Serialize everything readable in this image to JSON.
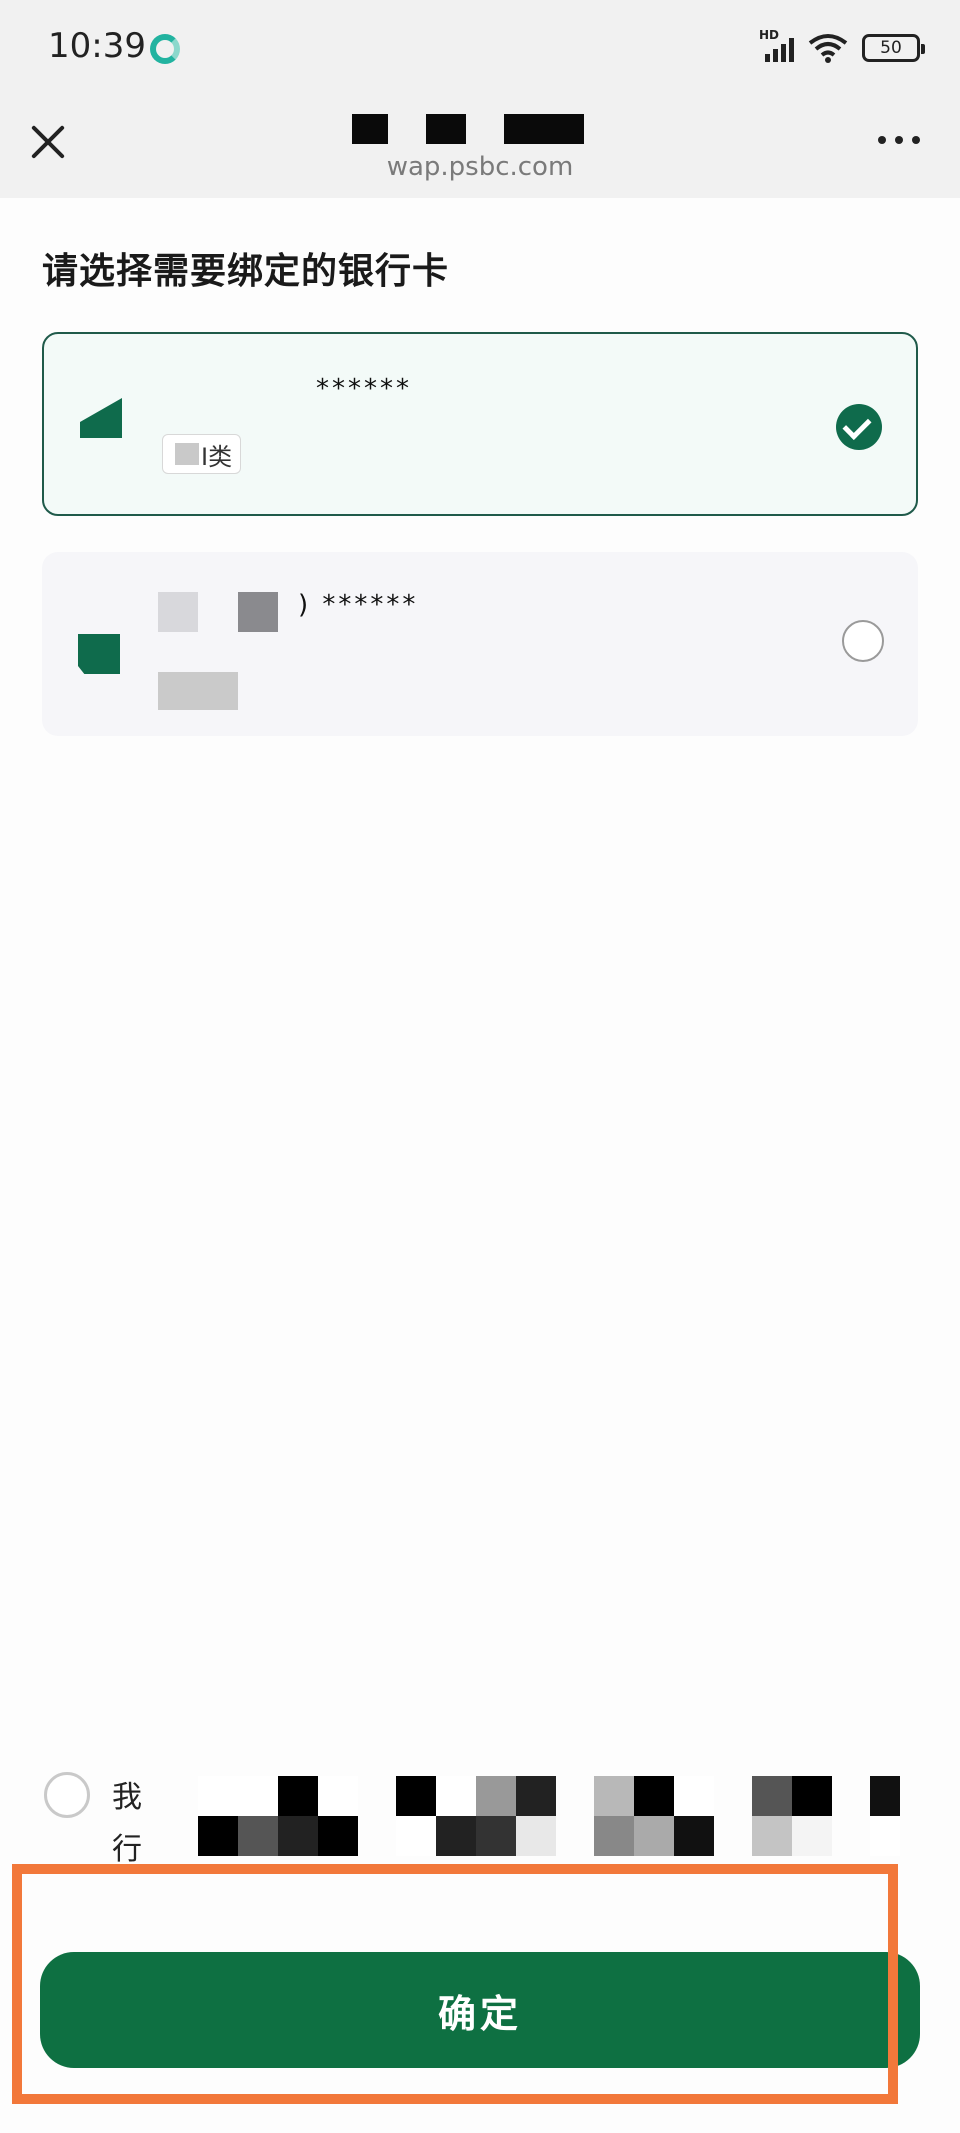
{
  "status_bar": {
    "time": "10:39",
    "network_badge": "HD",
    "battery_level": "50"
  },
  "browser": {
    "url": "wap.psbc.com",
    "close_icon": "close-icon",
    "more_icon": "more-icon"
  },
  "page": {
    "title": "请选择需要绑定的银行卡"
  },
  "cards": [
    {
      "number_masked": "****** ",
      "type_tag": "I类",
      "selected": true
    },
    {
      "number_masked": ") ****** ",
      "selected": false
    }
  ],
  "agreement": {
    "line1_start": "我",
    "line2_start": "行"
  },
  "actions": {
    "confirm_label": "确定"
  },
  "colors": {
    "brand_green": "#0e7042",
    "highlight_orange": "#f2783a",
    "selected_card_border": "#1f5a4a"
  }
}
